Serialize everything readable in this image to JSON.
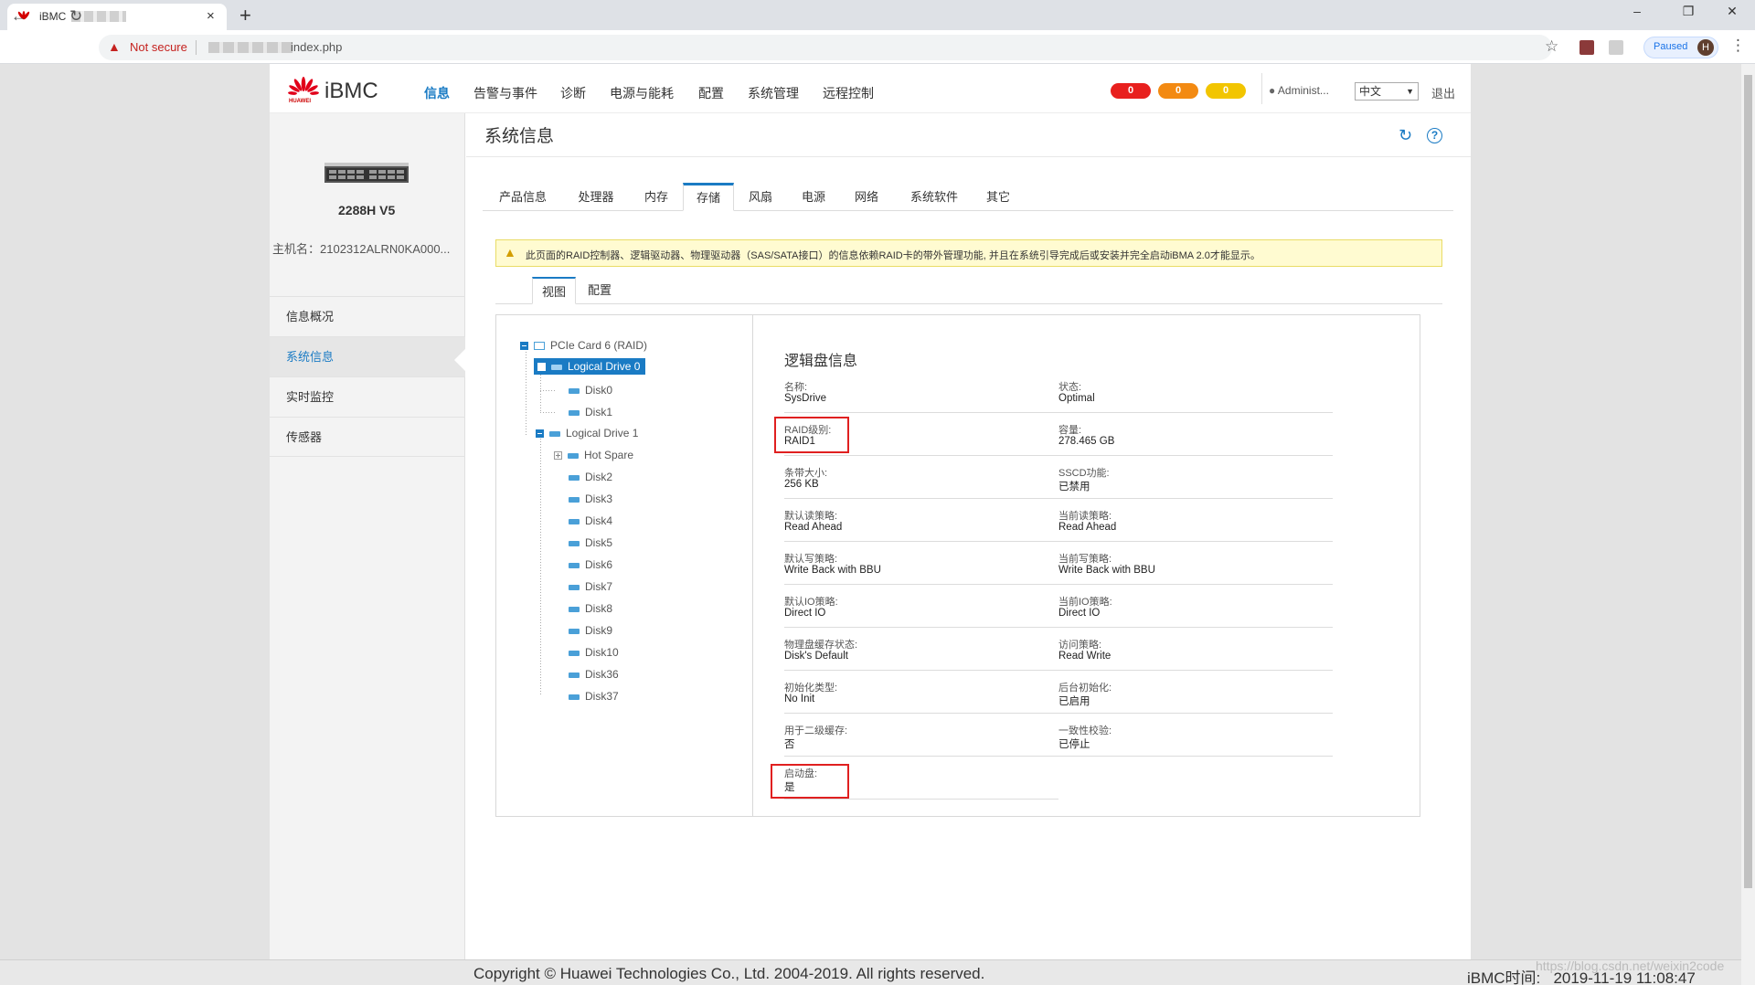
{
  "browser": {
    "tab_title": "iBMC",
    "tab_close": "×",
    "new_tab": "+",
    "not_secure": "Not secure",
    "url": "index.php",
    "paused": "Paused",
    "avatar": "H",
    "win_min": "–",
    "win_restore": "❐",
    "win_close": "✕",
    "back": "←",
    "forward": "→",
    "reload": "↻",
    "star": "☆",
    "kebab": "⋮",
    "warn": "▲"
  },
  "header": {
    "brand": "iBMC",
    "logo_sub": "HUAWEI",
    "nav": [
      "信息",
      "告警与事件",
      "诊断",
      "电源与能耗",
      "配置",
      "系统管理",
      "远程控制"
    ],
    "active_nav": 0,
    "alarms": [
      {
        "count": "0",
        "color": "#e8201e"
      },
      {
        "count": "0",
        "color": "#f38a12"
      },
      {
        "count": "0",
        "color": "#f2c500"
      }
    ],
    "user": "Administ...",
    "language": "中文",
    "logout": "退出"
  },
  "sidebar": {
    "model": "2288H V5",
    "hostname": "主机名：2102312ALRN0KA000...",
    "items": [
      "信息概况",
      "系统信息",
      "实时监控",
      "传感器"
    ],
    "active_item": 1
  },
  "page": {
    "title": "系统信息",
    "tabs": [
      "产品信息",
      "处理器",
      "内存",
      "存储",
      "风扇",
      "电源",
      "网络",
      "系统软件",
      "其它"
    ],
    "active_tab": 3,
    "notice": "此页面的RAID控制器、逻辑驱动器、物理驱动器（SAS/SATA接口）的信息依赖RAID卡的带外管理功能, 并且在系统引导完成后或安装并完全启动iBMA 2.0才能显示。",
    "subtabs": [
      "视图",
      "配置"
    ],
    "active_subtab": 0
  },
  "tree": {
    "card": "PCIe Card 6 (RAID)",
    "ld0": "Logical Drive 0",
    "ld0_disks": [
      "Disk0",
      "Disk1"
    ],
    "ld1": "Logical Drive 1",
    "hot_spare": "Hot Spare",
    "ld1_disks": [
      "Disk2",
      "Disk3",
      "Disk4",
      "Disk5",
      "Disk6",
      "Disk7",
      "Disk8",
      "Disk9",
      "Disk10",
      "Disk36",
      "Disk37"
    ]
  },
  "info": {
    "title": "逻辑盘信息",
    "rows": [
      [
        {
          "label": "名称:",
          "value": "SysDrive"
        },
        {
          "label": "状态:",
          "value": "Optimal"
        }
      ],
      [
        {
          "label": "RAID级别:",
          "value": "RAID1"
        },
        {
          "label": "容量:",
          "value": "278.465 GB"
        }
      ],
      [
        {
          "label": "条带大小:",
          "value": "256 KB"
        },
        {
          "label": "SSCD功能:",
          "value": "已禁用"
        }
      ],
      [
        {
          "label": "默认读策略:",
          "value": "Read Ahead"
        },
        {
          "label": "当前读策略:",
          "value": "Read Ahead"
        }
      ],
      [
        {
          "label": "默认写策略:",
          "value": "Write Back with BBU"
        },
        {
          "label": "当前写策略:",
          "value": "Write Back with BBU"
        }
      ],
      [
        {
          "label": "默认IO策略:",
          "value": "Direct IO"
        },
        {
          "label": "当前IO策略:",
          "value": "Direct IO"
        }
      ],
      [
        {
          "label": "物理盘缓存状态:",
          "value": "Disk's Default"
        },
        {
          "label": "访问策略:",
          "value": "Read Write"
        }
      ],
      [
        {
          "label": "初始化类型:",
          "value": "No Init"
        },
        {
          "label": "后台初始化:",
          "value": "已启用"
        }
      ],
      [
        {
          "label": "用于二级缓存:",
          "value": "否"
        },
        {
          "label": "一致性校验:",
          "value": "已停止"
        }
      ],
      [
        {
          "label": "启动盘:",
          "value": "是"
        }
      ]
    ]
  },
  "footer": {
    "copyright": "Copyright © Huawei Technologies Co., Ltd. 2004-2019. All rights reserved.",
    "time": "iBMC时间:   2019-11-19 11:08:47",
    "watermark": "https://blog.csdn.net/weixin2code"
  }
}
